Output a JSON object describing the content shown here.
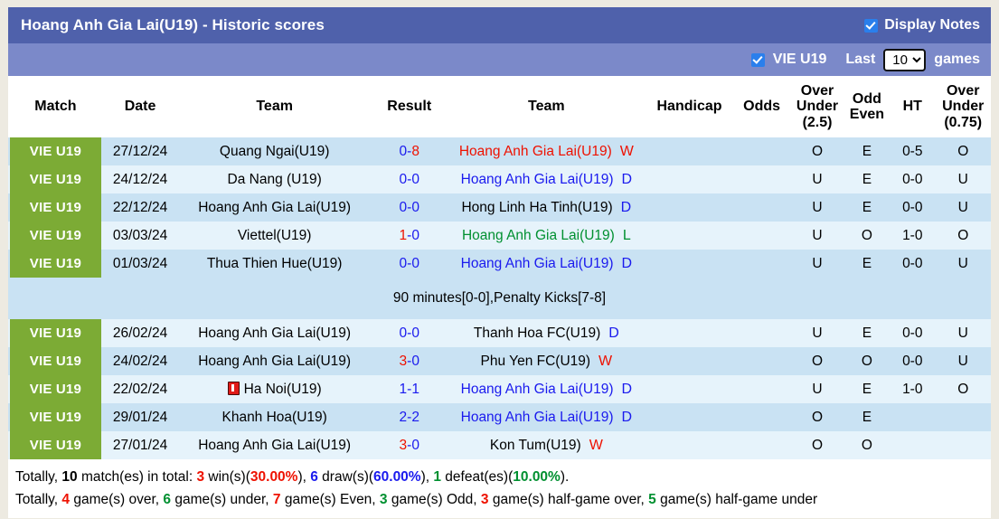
{
  "header": {
    "title": "Hoang Anh Gia Lai(U19) - Historic scores",
    "display_notes_label": "Display Notes",
    "display_notes_checked": true,
    "league_label": "VIE U19",
    "league_checked": true,
    "last_label": "Last",
    "games_label": "games",
    "count_value": "10",
    "count_options": [
      "10"
    ]
  },
  "colors": {
    "titlebar": "#4f61ab",
    "subbar": "#7b89c9",
    "badge_green": "#7cab35",
    "row_a": "#c9e2f3",
    "row_b": "#e6f3fb",
    "blue": "#1a1aee",
    "red": "#ee1100",
    "green": "#009030",
    "page_bg": "#edeae1"
  },
  "table": {
    "columns": [
      {
        "key": "match",
        "label": "Match"
      },
      {
        "key": "date",
        "label": "Date"
      },
      {
        "key": "home",
        "label": "Team"
      },
      {
        "key": "result",
        "label": "Result"
      },
      {
        "key": "away",
        "label": "Team"
      },
      {
        "key": "handicap",
        "label": "Handicap"
      },
      {
        "key": "odds",
        "label": "Odds"
      },
      {
        "key": "over_under_25",
        "label": "Over Under (2.5)"
      },
      {
        "key": "odd_even",
        "label": "Odd Even"
      },
      {
        "key": "ht",
        "label": "HT"
      },
      {
        "key": "over_under_075",
        "label": "Over Under (0.75)"
      }
    ],
    "column_labels_multiline": {
      "over_under_25_l1": "Over",
      "over_under_25_l2": "Under",
      "over_under_25_l3": "(2.5)",
      "odd_even_l1": "Odd",
      "odd_even_l2": "Even",
      "over_under_075_l1": "Over",
      "over_under_075_l2": "Under",
      "over_under_075_l3": "(0.75)"
    },
    "rows": [
      {
        "match": "VIE U19",
        "date": "27/12/24",
        "home": "Quang Ngai(U19)",
        "home_color": "black",
        "score_left": "0",
        "score_left_color": "blue",
        "score_right": "8",
        "score_right_color": "red",
        "away": "Hoang Anh Gia Lai(U19)",
        "away_color": "red",
        "wld": "W",
        "wld_color": "red",
        "handicap": "",
        "odds": "",
        "ou25": "O",
        "ou25_color": "red",
        "oddeven": "E",
        "oddeven_color": "red",
        "ht": "0-5",
        "ou075": "O",
        "ou075_color": "red",
        "red_card_home": false
      },
      {
        "match": "VIE U19",
        "date": "24/12/24",
        "home": "Da Nang (U19)",
        "home_color": "black",
        "score_left": "0",
        "score_left_color": "blue",
        "score_right": "0",
        "score_right_color": "blue",
        "away": "Hoang Anh Gia Lai(U19)",
        "away_color": "blue",
        "wld": "D",
        "wld_color": "blue",
        "handicap": "",
        "odds": "",
        "ou25": "U",
        "ou25_color": "green",
        "oddeven": "E",
        "oddeven_color": "red",
        "ht": "0-0",
        "ou075": "U",
        "ou075_color": "green",
        "red_card_home": false
      },
      {
        "match": "VIE U19",
        "date": "22/12/24",
        "home": "Hoang Anh Gia Lai(U19)",
        "home_color": "blue",
        "score_left": "0",
        "score_left_color": "blue",
        "score_right": "0",
        "score_right_color": "blue",
        "away": "Hong Linh Ha Tinh(U19)",
        "away_color": "black",
        "wld": "D",
        "wld_color": "blue",
        "handicap": "",
        "odds": "",
        "ou25": "U",
        "ou25_color": "green",
        "oddeven": "E",
        "oddeven_color": "red",
        "ht": "0-0",
        "ou075": "U",
        "ou075_color": "green",
        "red_card_home": false
      },
      {
        "match": "VIE U19",
        "date": "03/03/24",
        "home": "Viettel(U19)",
        "home_color": "black",
        "score_left": "1",
        "score_left_color": "red",
        "score_right": "0",
        "score_right_color": "blue",
        "away": "Hoang Anh Gia Lai(U19)",
        "away_color": "green",
        "wld": "L",
        "wld_color": "green",
        "handicap": "",
        "odds": "",
        "ou25": "U",
        "ou25_color": "green",
        "oddeven": "O",
        "oddeven_color": "green",
        "ht": "1-0",
        "ou075": "O",
        "ou075_color": "red",
        "red_card_home": false
      },
      {
        "match": "VIE U19",
        "date": "01/03/24",
        "home": "Thua Thien Hue(U19)",
        "home_color": "black",
        "score_left": "0",
        "score_left_color": "blue",
        "score_right": "0",
        "score_right_color": "blue",
        "away": "Hoang Anh Gia Lai(U19)",
        "away_color": "blue",
        "wld": "D",
        "wld_color": "blue",
        "handicap": "",
        "odds": "",
        "ou25": "U",
        "ou25_color": "green",
        "oddeven": "E",
        "oddeven_color": "red",
        "ht": "0-0",
        "ou075": "U",
        "ou075_color": "green",
        "red_card_home": false,
        "note": "90 minutes[0-0],Penalty Kicks[7-8]"
      },
      {
        "match": "VIE U19",
        "date": "26/02/24",
        "home": "Hoang Anh Gia Lai(U19)",
        "home_color": "blue",
        "score_left": "0",
        "score_left_color": "blue",
        "score_right": "0",
        "score_right_color": "blue",
        "away": "Thanh Hoa FC(U19)",
        "away_color": "black",
        "wld": "D",
        "wld_color": "blue",
        "handicap": "",
        "odds": "",
        "ou25": "U",
        "ou25_color": "green",
        "oddeven": "E",
        "oddeven_color": "red",
        "ht": "0-0",
        "ou075": "U",
        "ou075_color": "green",
        "red_card_home": false
      },
      {
        "match": "VIE U19",
        "date": "24/02/24",
        "home": "Hoang Anh Gia Lai(U19)",
        "home_color": "red",
        "score_left": "3",
        "score_left_color": "red",
        "score_right": "0",
        "score_right_color": "blue",
        "away": "Phu Yen FC(U19)",
        "away_color": "black",
        "wld": "W",
        "wld_color": "red",
        "handicap": "",
        "odds": "",
        "ou25": "O",
        "ou25_color": "red",
        "oddeven": "O",
        "oddeven_color": "green",
        "ht": "0-0",
        "ou075": "U",
        "ou075_color": "green",
        "red_card_home": false
      },
      {
        "match": "VIE U19",
        "date": "22/02/24",
        "home": "Ha Noi(U19)",
        "home_color": "black",
        "score_left": "1",
        "score_left_color": "blue",
        "score_right": "1",
        "score_right_color": "blue",
        "away": "Hoang Anh Gia Lai(U19)",
        "away_color": "blue",
        "wld": "D",
        "wld_color": "blue",
        "handicap": "",
        "odds": "",
        "ou25": "U",
        "ou25_color": "green",
        "oddeven": "E",
        "oddeven_color": "red",
        "ht": "1-0",
        "ou075": "O",
        "ou075_color": "red",
        "red_card_home": true
      },
      {
        "match": "VIE U19",
        "date": "29/01/24",
        "home": "Khanh Hoa(U19)",
        "home_color": "black",
        "score_left": "2",
        "score_left_color": "blue",
        "score_right": "2",
        "score_right_color": "blue",
        "away": "Hoang Anh Gia Lai(U19)",
        "away_color": "blue",
        "wld": "D",
        "wld_color": "blue",
        "handicap": "",
        "odds": "",
        "ou25": "O",
        "ou25_color": "red",
        "oddeven": "E",
        "oddeven_color": "red",
        "ht": "",
        "ou075": "",
        "ou075_color": "black",
        "red_card_home": false
      },
      {
        "match": "VIE U19",
        "date": "27/01/24",
        "home": "Hoang Anh Gia Lai(U19)",
        "home_color": "red",
        "score_left": "3",
        "score_left_color": "red",
        "score_right": "0",
        "score_right_color": "blue",
        "away": "Kon Tum(U19)",
        "away_color": "black",
        "wld": "W",
        "wld_color": "red",
        "handicap": "",
        "odds": "",
        "ou25": "O",
        "ou25_color": "red",
        "oddeven": "O",
        "oddeven_color": "green",
        "ht": "",
        "ou075": "",
        "ou075_color": "black",
        "red_card_home": false
      }
    ]
  },
  "footer": {
    "line1": {
      "t1": "Totally, ",
      "total": "10",
      "t2": " match(es) in total: ",
      "wins": "3",
      "t3": " win(s)(",
      "win_pct": "30.00%",
      "t4": "), ",
      "draws": "6",
      "t5": " draw(s)(",
      "draw_pct": "60.00%",
      "t6": "), ",
      "defeats": "1",
      "t7": " defeat(es)(",
      "defeat_pct": "10.00%",
      "t8": ")."
    },
    "line2": {
      "t1": "Totally, ",
      "over": "4",
      "t2": " game(s) over, ",
      "under": "6",
      "t3": " game(s) under, ",
      "even": "7",
      "t4": " game(s) Even, ",
      "odd": "3",
      "t5": " game(s) Odd, ",
      "half_over": "3",
      "t6": " game(s) half-game over, ",
      "half_under": "5",
      "t7": " game(s) half-game under"
    }
  }
}
